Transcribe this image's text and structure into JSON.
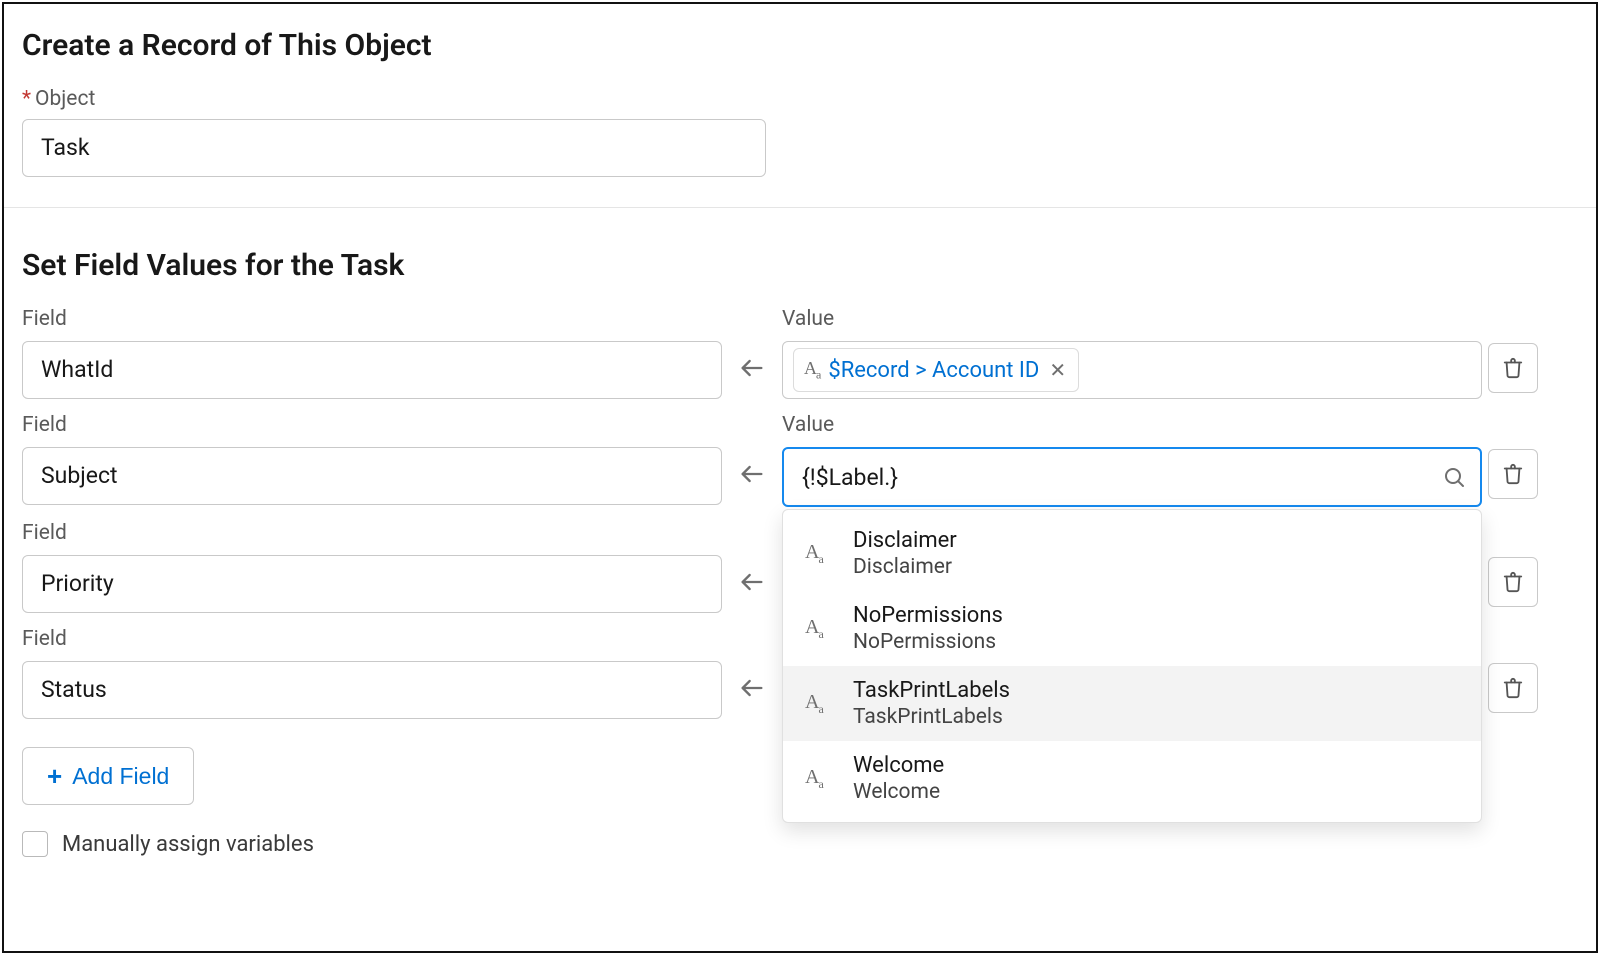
{
  "colors": {
    "accent": "#0070d2",
    "focus": "#1589ee",
    "danger": "#c23934"
  },
  "section1": {
    "title": "Create a Record of This Object",
    "objectLabel": "Object",
    "objectValue": "Task"
  },
  "section2": {
    "title": "Set Field Values for the Task",
    "fieldLabel": "Field",
    "valueLabel": "Value",
    "rows": [
      {
        "field": "WhatId",
        "valueType": "pill",
        "pillText": "$Record > Account ID"
      },
      {
        "field": "Subject",
        "valueType": "search",
        "searchText": "{!$Label.}"
      },
      {
        "field": "Priority",
        "valueType": "hidden"
      },
      {
        "field": "Status",
        "valueType": "hidden"
      }
    ],
    "addFieldLabel": "Add Field",
    "checkboxLabel": "Manually assign variables"
  },
  "dropdown": {
    "items": [
      {
        "title": "Disclaimer",
        "sub": "Disclaimer"
      },
      {
        "title": "NoPermissions",
        "sub": "NoPermissions"
      },
      {
        "title": "TaskPrintLabels",
        "sub": "TaskPrintLabels",
        "hover": true
      },
      {
        "title": "Welcome",
        "sub": "Welcome"
      }
    ]
  },
  "icons": {
    "arrowLeft": "arrow-left-icon",
    "trash": "trash-icon",
    "search": "search-icon",
    "close": "close-icon",
    "text": "text-icon",
    "plus": "plus-icon"
  }
}
